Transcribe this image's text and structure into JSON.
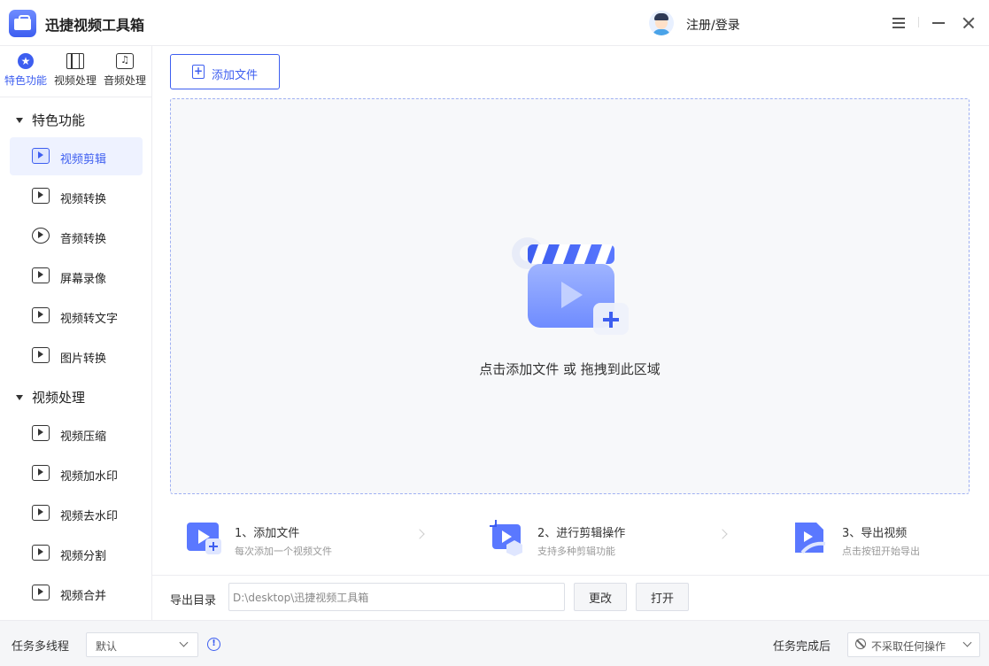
{
  "app": {
    "title": "迅捷视频工具箱"
  },
  "header": {
    "login_label": "注册/登录"
  },
  "sidebar": {
    "tabs": [
      {
        "label": "特色功能",
        "icon": "star-icon",
        "active": true
      },
      {
        "label": "视频处理",
        "icon": "film-icon",
        "active": false
      },
      {
        "label": "音频处理",
        "icon": "music-icon",
        "active": false
      }
    ],
    "sections": [
      {
        "title": "特色功能",
        "items": [
          "视频剪辑",
          "视频转换",
          "音频转换",
          "屏幕录像",
          "视频转文字",
          "图片转换"
        ]
      },
      {
        "title": "视频处理",
        "items": [
          "视频压缩",
          "视频加水印",
          "视频去水印",
          "视频分割",
          "视频合并"
        ]
      }
    ]
  },
  "main": {
    "add_file_label": "添加文件",
    "drop_text": "点击添加文件 或 拖拽到此区域",
    "steps": [
      {
        "title": "1、添加文件",
        "desc": "每次添加一个视频文件"
      },
      {
        "title": "2、进行剪辑操作",
        "desc": "支持多种剪辑功能"
      },
      {
        "title": "3、导出视频",
        "desc": "点击按钮开始导出"
      }
    ],
    "export": {
      "label": "导出目录",
      "path": "D:\\desktop\\迅捷视频工具箱",
      "change_label": "更改",
      "open_label": "打开"
    }
  },
  "footer": {
    "multithread_label": "任务多线程",
    "multithread_value": "默认",
    "after_task_label": "任务完成后",
    "after_task_value": "不采取任何操作"
  },
  "colors": {
    "accent": "#3d5ef0",
    "dropzone_bg": "#f7f8fa",
    "dropzone_border": "#9fb0f2"
  }
}
